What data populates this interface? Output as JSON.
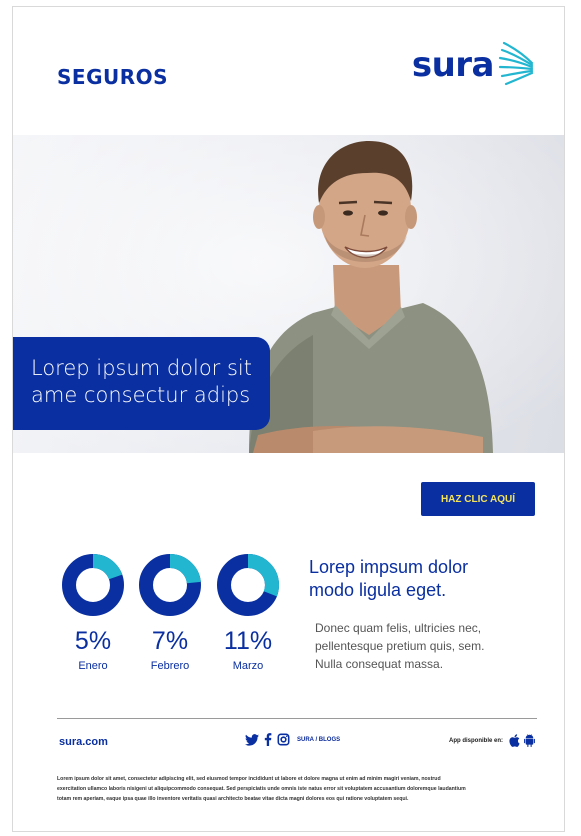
{
  "colors": {
    "primary": "#0a2fa0",
    "accent": "#22b6d0",
    "cta_text": "#f3e35d",
    "text_gray": "#555555"
  },
  "header": {
    "brand_title": "SEGUROS",
    "logo_text": "sura",
    "logo_icon": "sura-wings-icon"
  },
  "hero": {
    "image": "smiling-man-photo",
    "banner_lines": [
      "Lorep ipsum dolor sit",
      "ame consectur adips"
    ]
  },
  "cta": {
    "label": "HAZ CLIC AQUÍ"
  },
  "stats": [
    {
      "value": "5%",
      "label": "Enero",
      "fraction": 0.05
    },
    {
      "value": "7%",
      "label": "Febrero",
      "fraction": 0.07
    },
    {
      "value": "11%",
      "label": "Marzo",
      "fraction": 0.11
    }
  ],
  "content": {
    "headline_lines": [
      "Lorep impsum dolor",
      "modo ligula eget."
    ],
    "body_lines": [
      "Donec quam felis, ultricies nec,",
      "pellentesque pretium quis, sem.",
      "Nulla consequat massa."
    ]
  },
  "footer": {
    "site": "sura.com",
    "social_label": "SURA / BLOGS",
    "social_icons": [
      "twitter-icon",
      "facebook-icon",
      "instagram-icon"
    ],
    "app_label": "App disponible en:",
    "app_icons": [
      "apple-icon",
      "android-icon"
    ],
    "legal_lines": [
      "Lorem ipsum dolor sit amet, consectetur adipiscing elit, sed eiusmod tempor incididunt ut labore et dolore magna ut enim ad minim magiri veniam,  nostrud",
      "exercitation ullamco laboris nisigeni ut aliquipcommodo consequat. Sed perspiciatis unde omnis iste natus error sit voluptatem accusantium doloremque laudantium",
      "totam rem aperiam, eaque ipsa quae illo inventore veritatis quasi architecto beatae vitae dicta magni dolores eos qui ratione voluptatem sequi."
    ]
  }
}
